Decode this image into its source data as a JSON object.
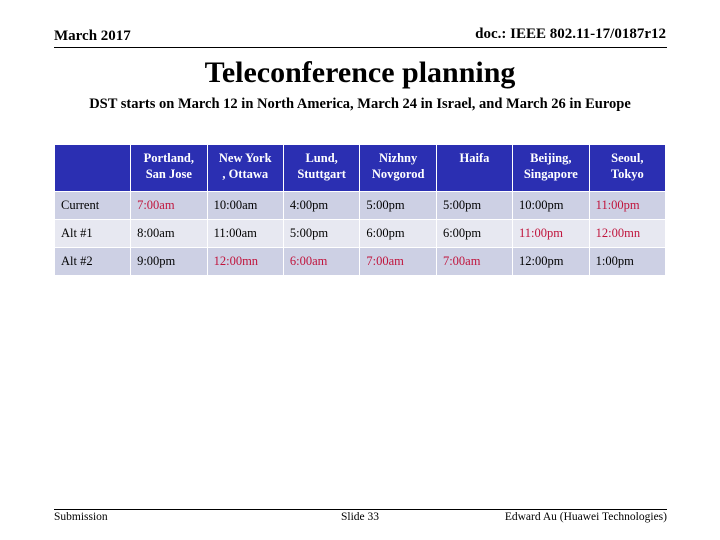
{
  "header": {
    "date": "March 2017",
    "doc_id": "doc.: IEEE 802.11-17/0187r12"
  },
  "title": "Teleconference planning",
  "subtitle": "DST starts on March 12 in North America, March 24 in Israel, and March 26 in Europe",
  "table": {
    "columns": [
      {
        "line1": "",
        "line2": ""
      },
      {
        "line1": "Portland,",
        "line2": "San Jose"
      },
      {
        "line1": "New York",
        "line2": ", Ottawa"
      },
      {
        "line1": "Lund,",
        "line2": "Stuttgart"
      },
      {
        "line1": "Nizhny",
        "line2": "Novgorod"
      },
      {
        "line1": "Haifa",
        "line2": ""
      },
      {
        "line1": "Beijing,",
        "line2": "Singapore"
      },
      {
        "line1": "Seoul,",
        "line2": "Tokyo"
      }
    ],
    "rows": [
      {
        "label": "Current",
        "cells": [
          {
            "text": "7:00am",
            "highlight": true
          },
          {
            "text": "10:00am",
            "highlight": false
          },
          {
            "text": "4:00pm",
            "highlight": false
          },
          {
            "text": "5:00pm",
            "highlight": false
          },
          {
            "text": "5:00pm",
            "highlight": false
          },
          {
            "text": "10:00pm",
            "highlight": false
          },
          {
            "text": "11:00pm",
            "highlight": true
          }
        ]
      },
      {
        "label": "Alt #1",
        "cells": [
          {
            "text": "8:00am",
            "highlight": false
          },
          {
            "text": "11:00am",
            "highlight": false
          },
          {
            "text": "5:00pm",
            "highlight": false
          },
          {
            "text": "6:00pm",
            "highlight": false
          },
          {
            "text": "6:00pm",
            "highlight": false
          },
          {
            "text": "11:00pm",
            "highlight": true
          },
          {
            "text": "12:00mn",
            "highlight": true
          }
        ]
      },
      {
        "label": "Alt #2",
        "cells": [
          {
            "text": "9:00pm",
            "highlight": false
          },
          {
            "text": "12:00mn",
            "highlight": true
          },
          {
            "text": "6:00am",
            "highlight": true
          },
          {
            "text": "7:00am",
            "highlight": true
          },
          {
            "text": "7:00am",
            "highlight": true
          },
          {
            "text": "12:00pm",
            "highlight": false
          },
          {
            "text": "1:00pm",
            "highlight": false
          }
        ]
      }
    ]
  },
  "colors": {
    "header_bg": "#2b2fb2",
    "row_odd_bg": "#cdd0e4",
    "row_even_bg": "#e7e8f1",
    "highlight_text": "#c0143c"
  },
  "footer": {
    "left": "Submission",
    "center": "Slide 33",
    "right": "Edward Au (Huawei Technologies)"
  }
}
